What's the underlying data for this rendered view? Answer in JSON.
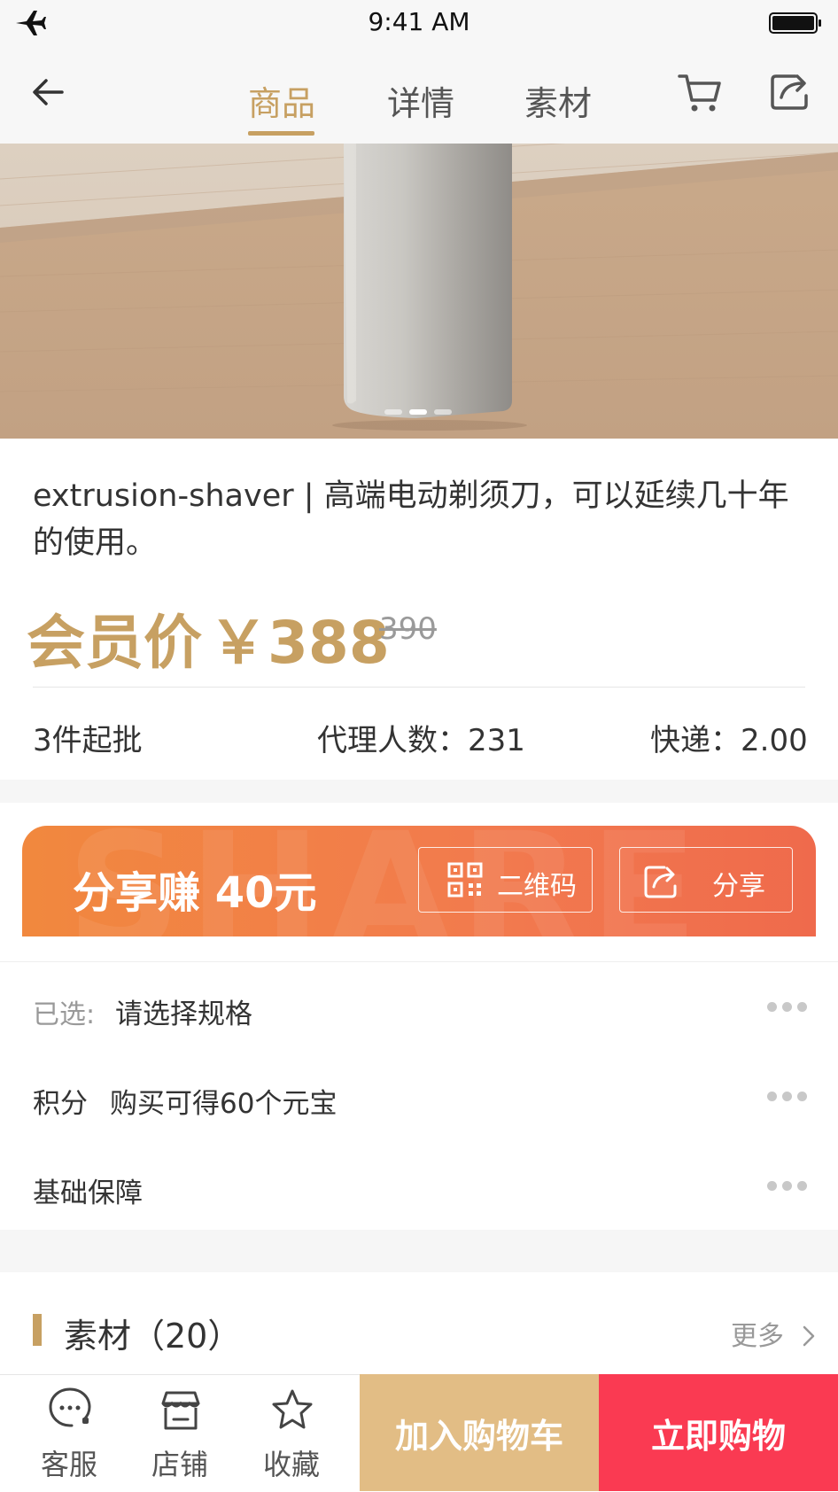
{
  "status_bar": {
    "time": "9:41 AM"
  },
  "nav": {
    "tabs": [
      {
        "label": "商品",
        "active": true
      },
      {
        "label": "详情",
        "active": false
      },
      {
        "label": "素材",
        "active": false
      }
    ],
    "accent_color": "#c7a062"
  },
  "gallery": {
    "page_count": 3,
    "current_page": 2
  },
  "product": {
    "title": "extrusion-shaver | 高端电动剃须刀，可以延续几十年的使用。",
    "price_label": "会员价",
    "price_value": "￥388",
    "original_price": "390",
    "min_order": "3件起批",
    "agents": "代理人数：231",
    "shipping": "快递：2.00"
  },
  "share_banner": {
    "text": "分享赚 40元",
    "background_text": "SHARE",
    "qrcode_label": "二维码",
    "share_label": "分享"
  },
  "options": {
    "spec_label": "已选:",
    "spec_value": "请选择规格",
    "points_label": "积分",
    "points_value": "购买可得60个元宝",
    "guarantee_label": "基础保障"
  },
  "materials": {
    "title": "素材（20）",
    "more_label": "更多"
  },
  "bottom_bar": {
    "service_label": "客服",
    "shop_label": "店铺",
    "favorite_label": "收藏",
    "add_cart_label": "加入购物车",
    "buy_now_label": "立即购物"
  },
  "colors": {
    "gold": "#c7a062",
    "add_cart": "#e2bd85",
    "buy_now": "#fa3a52",
    "banner": "#f1883e"
  }
}
